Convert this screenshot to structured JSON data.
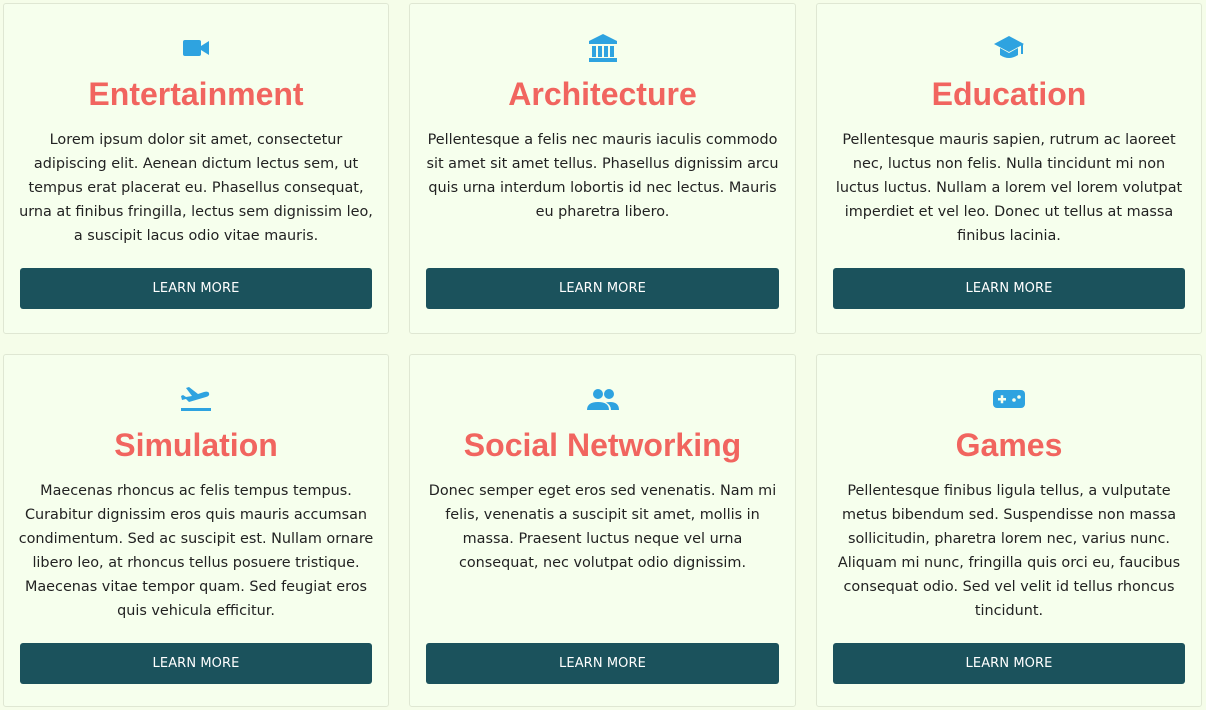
{
  "cards": [
    {
      "icon": "video-camera-icon",
      "title": "Entertainment",
      "description": "Lorem ipsum dolor sit amet, consectetur adipiscing elit. Aenean dictum lectus sem, ut tempus erat placerat eu. Phasellus consequat, urna at finibus fringilla, lectus sem dignissim leo, a suscipit lacus odio vitae mauris.",
      "button_label": "LEARN MORE"
    },
    {
      "icon": "bank-building-icon",
      "title": "Architecture",
      "description": "Pellentesque a felis nec mauris iaculis commodo sit amet sit amet tellus. Phasellus dignissim arcu quis urna interdum lobortis id nec lectus. Mauris eu pharetra libero.",
      "button_label": "LEARN MORE"
    },
    {
      "icon": "graduation-cap-icon",
      "title": "Education",
      "description": "Pellentesque mauris sapien, rutrum ac laoreet nec, luctus non felis. Nulla tincidunt mi non luctus luctus. Nullam a lorem vel lorem volutpat imperdiet et vel leo. Donec ut tellus at massa finibus lacinia.",
      "button_label": "LEARN MORE"
    },
    {
      "icon": "airplane-takeoff-icon",
      "title": "Simulation",
      "description": "Maecenas rhoncus ac felis tempus tempus. Curabitur dignissim eros quis mauris accumsan condimentum. Sed ac suscipit est. Nullam ornare libero leo, at rhoncus tellus posuere tristique. Maecenas vitae tempor quam. Sed feugiat eros quis vehicula efficitur.",
      "button_label": "LEARN MORE"
    },
    {
      "icon": "people-group-icon",
      "title": "Social Networking",
      "description": "Donec semper eget eros sed venenatis. Nam mi felis, venenatis a suscipit sit amet, mollis in massa. Praesent luctus neque vel urna consequat, nec volutpat odio dignissim.",
      "button_label": "LEARN MORE"
    },
    {
      "icon": "gamepad-icon",
      "title": "Games",
      "description": "Pellentesque finibus ligula tellus, a vulputate metus bibendum sed. Suspendisse non massa sollicitudin, pharetra lorem nec, varius nunc. Aliquam mi nunc, fringilla quis orci eu, faucibus consequat odio. Sed vel velit id tellus rhoncus tincidunt.",
      "button_label": "LEARN MORE"
    }
  ],
  "colors": {
    "background": "#f5fde9",
    "card_background": "#f6ffed",
    "title": "#f1655f",
    "icon": "#2ea3e0",
    "button": "#1b525c",
    "button_text": "#ffffff",
    "body_text": "#222222"
  }
}
